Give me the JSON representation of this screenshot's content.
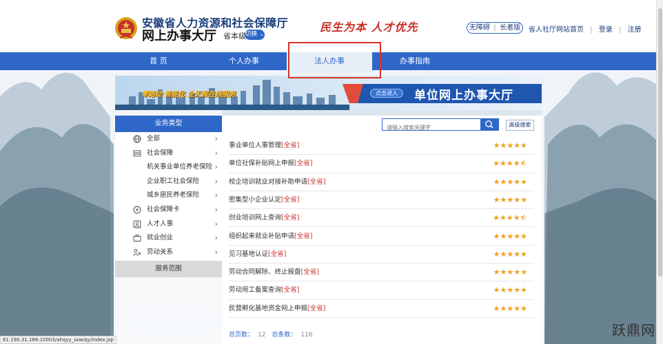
{
  "header": {
    "title_line1": "安徽省人力资源和社会保障厅",
    "title_line2": "网上办事大厅",
    "level_label": "省本级",
    "switch_label": "切换",
    "slogan": "民生为本  人才优先",
    "accessibility": [
      "无障碍",
      "长者版"
    ],
    "links": [
      "省人社厅网站首页",
      "登录",
      "注册"
    ],
    "separator": "|"
  },
  "nav": {
    "items": [
      "首 页",
      "个人办事",
      "法人办事",
      "办事指南"
    ],
    "active_index": 2
  },
  "banner": {
    "left_slogan": "零跑动  智能化  全天候在线服务",
    "button_label": "点击进入",
    "big_text": "单位网上办事大厅"
  },
  "sidebar": {
    "header": "业务类型",
    "items": [
      {
        "label": "全部",
        "icon": "globe-icon",
        "chevron": true,
        "sub": false
      },
      {
        "label": "社会保障",
        "icon": "card-stack-icon",
        "chevron": true,
        "sub": false
      },
      {
        "label": "机关事业单位养老保险",
        "icon": "",
        "chevron": true,
        "sub": true
      },
      {
        "label": "企业职工社会保险",
        "icon": "",
        "chevron": true,
        "sub": true
      },
      {
        "label": "城乡居民养老保险",
        "icon": "",
        "chevron": true,
        "sub": true
      },
      {
        "label": "社会保障卡",
        "icon": "social-card-icon",
        "chevron": true,
        "sub": false
      },
      {
        "label": "人才人事",
        "icon": "person-icon",
        "chevron": true,
        "sub": false
      },
      {
        "label": "就业创业",
        "icon": "briefcase-icon",
        "chevron": true,
        "sub": false
      },
      {
        "label": "劳动关系",
        "icon": "handshake-icon",
        "chevron": true,
        "sub": false
      }
    ],
    "footer": "服务范围",
    "chevron_glyph": "›"
  },
  "search": {
    "placeholder": "请输入搜索关键字",
    "advanced_label": "高级搜索"
  },
  "services": [
    {
      "name": "事业单位人事管理",
      "tag": "[全省]",
      "rating": 5
    },
    {
      "name": "单位社保补贴网上申报",
      "tag": "[全省]",
      "rating": 4.5
    },
    {
      "name": "校企培训就业对接补助申请",
      "tag": "[全省]",
      "rating": 5
    },
    {
      "name": "密集型小企业认定",
      "tag": "[全省]",
      "rating": 5
    },
    {
      "name": "创业培训网上查询",
      "tag": "[全省]",
      "rating": 4.5
    },
    {
      "name": "组织起来就业补贴申请",
      "tag": "[全省]",
      "rating": 5
    },
    {
      "name": "见习基地认证",
      "tag": "[全省]",
      "rating": 5
    },
    {
      "name": "劳动合同解除、终止报盘",
      "tag": "[全省]",
      "rating": 5
    },
    {
      "name": "劳动用工备案查询",
      "tag": "[全省]",
      "rating": 5
    },
    {
      "name": "民营孵化基地资金网上申报",
      "tag": "[全省]",
      "rating": 5
    }
  ],
  "pager": {
    "pages_label": "总页数：",
    "pages": "12",
    "total_label": "总条数：",
    "total": "116"
  },
  "status_url": "61.190.31.166:10003/ahqyy_szw/qy/index.jsp",
  "watermark": "跃鼎网",
  "colors": {
    "primary": "#2f67c9",
    "accent_red": "#c8302a",
    "star": "#f0a020"
  }
}
